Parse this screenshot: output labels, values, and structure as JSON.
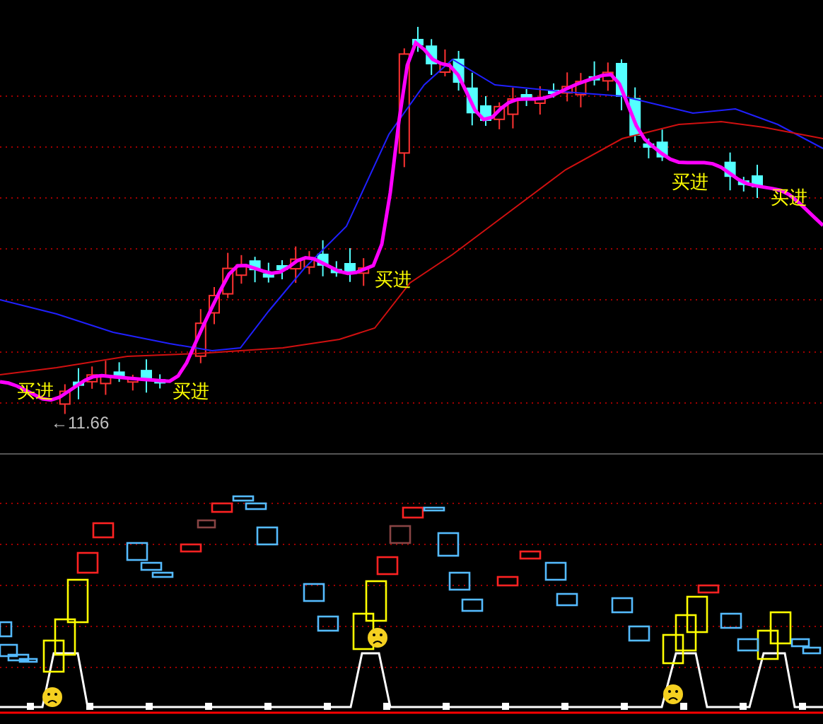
{
  "buy_signals": [
    {
      "label": "买进"
    },
    {
      "label": "买进"
    },
    {
      "label": "买进"
    },
    {
      "label": "买进"
    },
    {
      "label": "买进"
    }
  ],
  "low_marker": {
    "label": "←11.66"
  }
}
